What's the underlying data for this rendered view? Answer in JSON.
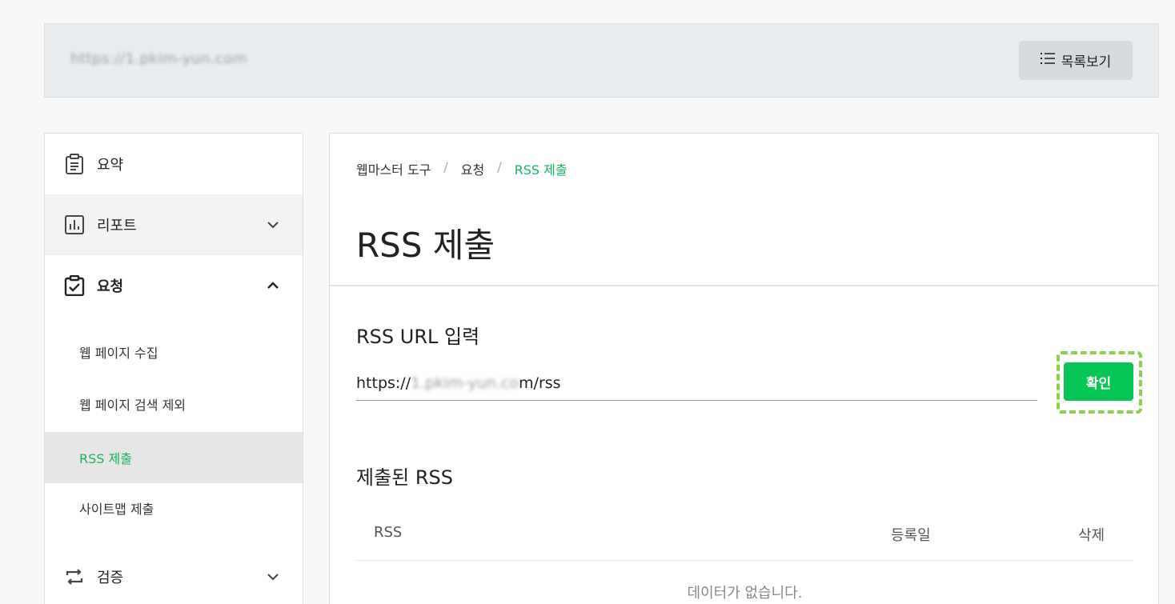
{
  "site_bar": {
    "url": "https://1.pkim-yun.com",
    "list_button_label": "목록보기"
  },
  "sidebar": {
    "items": [
      {
        "label": "요약",
        "icon": "clipboard-icon"
      },
      {
        "label": "리포트",
        "icon": "bar-chart-icon",
        "expanded": false
      },
      {
        "label": "요청",
        "icon": "clipboard-check-icon",
        "expanded": true
      },
      {
        "label": "검증",
        "icon": "repeat-icon",
        "expanded": false
      }
    ],
    "sub_items": [
      {
        "label": "웹 페이지 수집"
      },
      {
        "label": "웹 페이지 검색 제외"
      },
      {
        "label": "RSS 제출",
        "active": true
      },
      {
        "label": "사이트맵 제출"
      }
    ]
  },
  "main": {
    "breadcrumb": [
      "웹마스터 도구",
      "요청",
      "RSS 제출"
    ],
    "breadcrumb_separator": "/",
    "title": "RSS 제출",
    "input_section_title": "RSS URL 입력",
    "url_input": {
      "prefix": "https://",
      "masked": "1.pkim-yun.co",
      "suffix": "m/rss"
    },
    "confirm_label": "확인",
    "submitted_section_title": "제출된 RSS",
    "table_headers": [
      "RSS",
      "등록일",
      "삭제"
    ],
    "empty_message": "데이터가 없습니다."
  },
  "colors": {
    "accent_green": "#06c755",
    "active_text_green": "#1ab55c",
    "highlight_dash": "#8bd14a"
  }
}
